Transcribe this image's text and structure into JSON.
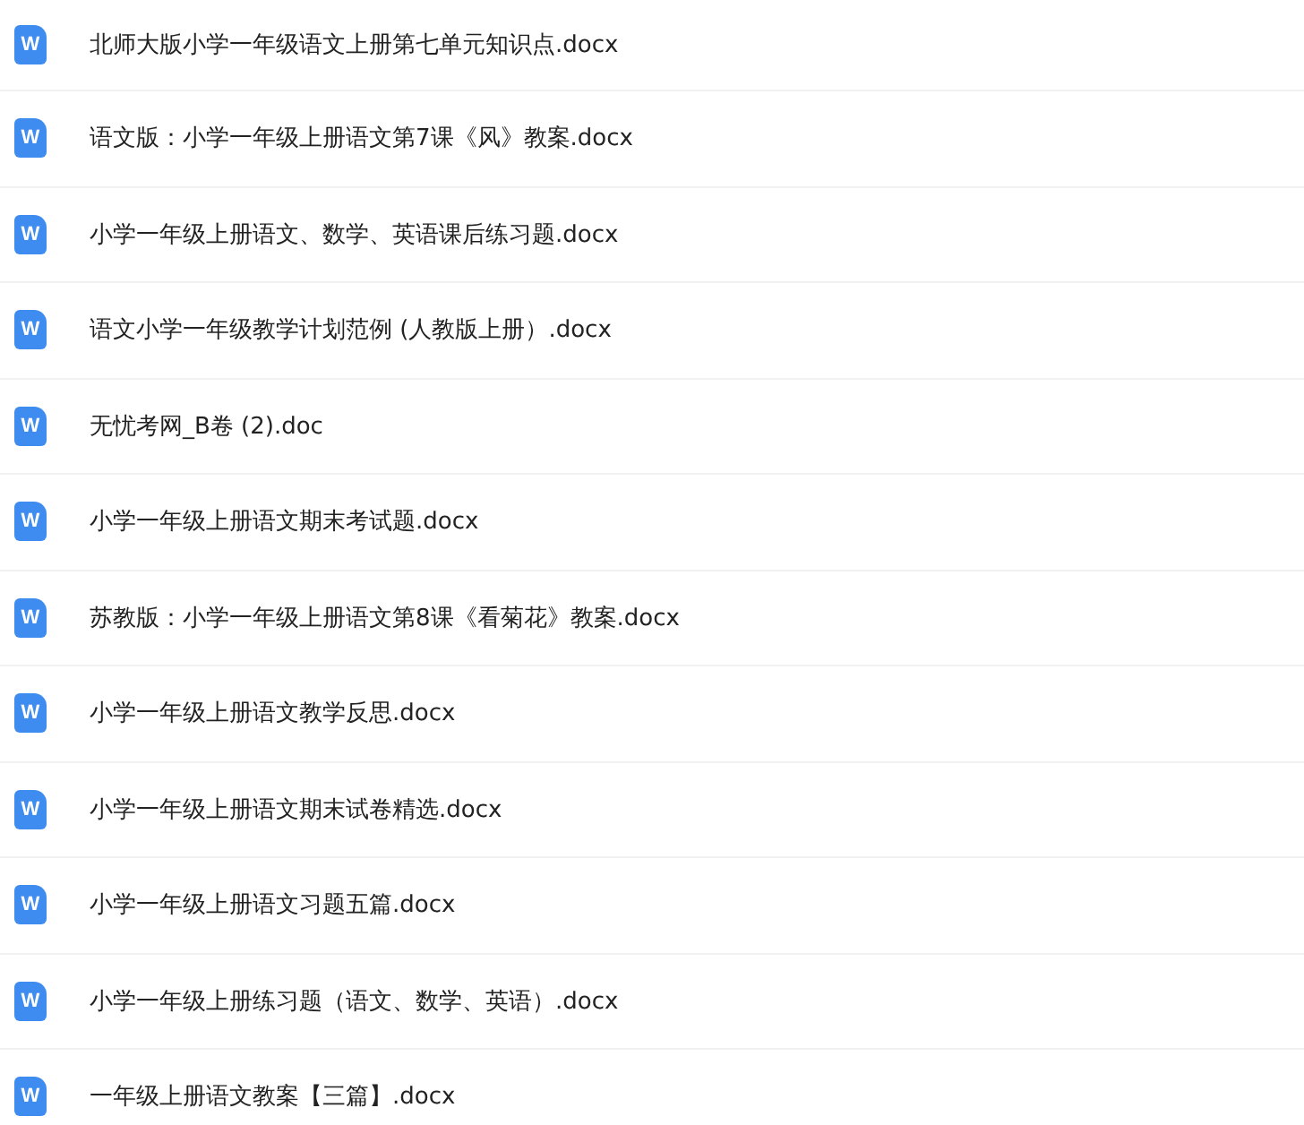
{
  "files": [
    {
      "name": "北师大版小学一年级语文上册第七单元知识点.docx",
      "icon_letter": "W"
    },
    {
      "name": "语文版：小学一年级上册语文第7课《风》教案.docx",
      "icon_letter": "W"
    },
    {
      "name": "小学一年级上册语文、数学、英语课后练习题.docx",
      "icon_letter": "W"
    },
    {
      "name": "语文小学一年级教学计划范例 (人教版上册）.docx",
      "icon_letter": "W"
    },
    {
      "name": "无忧考网_B卷 (2).doc",
      "icon_letter": "W"
    },
    {
      "name": "小学一年级上册语文期末考试题.docx",
      "icon_letter": "W"
    },
    {
      "name": "苏教版：小学一年级上册语文第8课《看菊花》教案.docx",
      "icon_letter": "W"
    },
    {
      "name": "小学一年级上册语文教学反思.docx",
      "icon_letter": "W"
    },
    {
      "name": "小学一年级上册语文期末试卷精选.docx",
      "icon_letter": "W"
    },
    {
      "name": "小学一年级上册语文习题五篇.docx",
      "icon_letter": "W"
    },
    {
      "name": "小学一年级上册练习题（语文、数学、英语）.docx",
      "icon_letter": "W"
    },
    {
      "name": "一年级上册语文教案【三篇】.docx",
      "icon_letter": "W"
    }
  ]
}
